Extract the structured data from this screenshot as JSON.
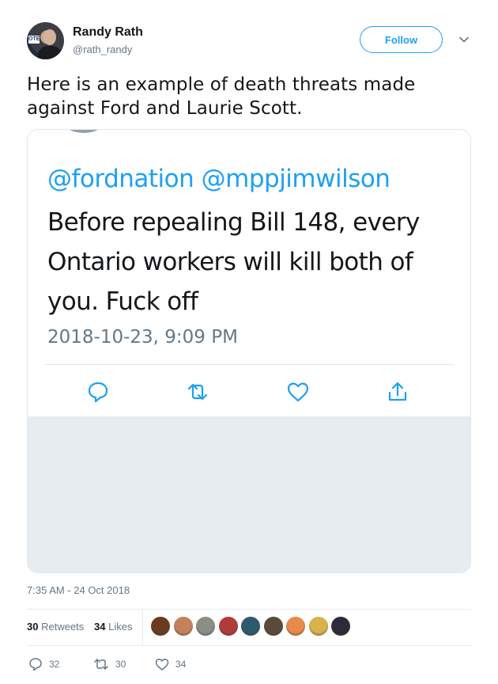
{
  "author": {
    "name": "Randy Rath",
    "handle": "@rath_randy",
    "avatar_sign": "OTE"
  },
  "header": {
    "follow_label": "Follow"
  },
  "tweet": {
    "text": "Here is an example of death threats made against Ford and Laurie Scott.",
    "timestamp": "7:35 AM - 24 Oct 2018"
  },
  "embedded": {
    "mentions": "@fordnation @mppjimwilson",
    "body": "Before repealing Bill 148, every Ontario workers will kill both of you. Fuck off",
    "date": "2018-10-23, 9:09 PM",
    "actions": [
      "reply-icon",
      "retweet-icon",
      "like-icon",
      "share-icon"
    ]
  },
  "stats": {
    "retweets_count": "30",
    "retweets_label": "Retweets",
    "likes_count": "34",
    "likes_label": "Likes",
    "likers": [
      "#6b3b1f",
      "#c4825a",
      "#8a8f86",
      "#b23a3a",
      "#2e5a6e",
      "#5a4a3a",
      "#e88a4a",
      "#d9b24a",
      "#2b2b3a"
    ]
  },
  "footer": {
    "replies": "32",
    "retweets": "30",
    "likes": "34"
  },
  "colors": {
    "accent": "#1da1f2",
    "muted": "#657786",
    "text": "#14171a"
  }
}
